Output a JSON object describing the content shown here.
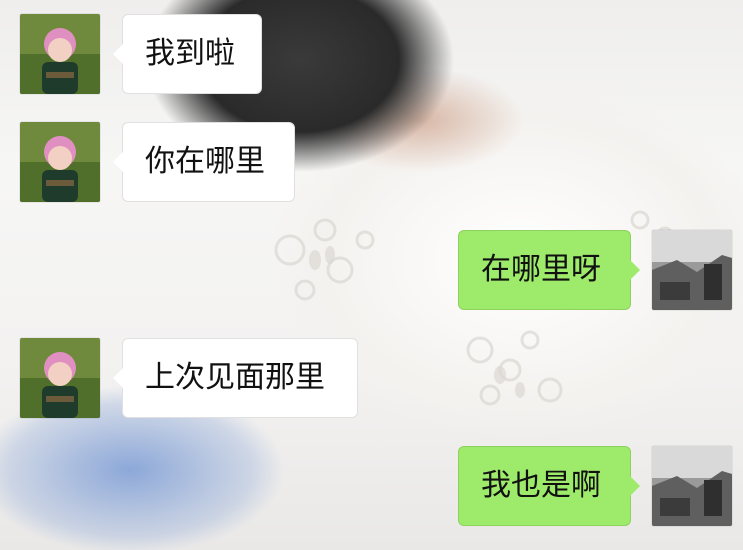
{
  "chat": {
    "messages": [
      {
        "side": "incoming",
        "text": "我到啦",
        "avatar": "friend-avatar"
      },
      {
        "side": "incoming",
        "text": "你在哪里",
        "avatar": "friend-avatar"
      },
      {
        "side": "outgoing",
        "text": "在哪里呀",
        "avatar": "self-avatar"
      },
      {
        "side": "incoming",
        "text": "上次见面那里",
        "avatar": "friend-avatar"
      },
      {
        "side": "outgoing",
        "text": "我也是啊",
        "avatar": "self-avatar"
      }
    ]
  },
  "colors": {
    "incoming_bubble": "#ffffff",
    "outgoing_bubble": "#9eea6a",
    "text": "#111111"
  }
}
